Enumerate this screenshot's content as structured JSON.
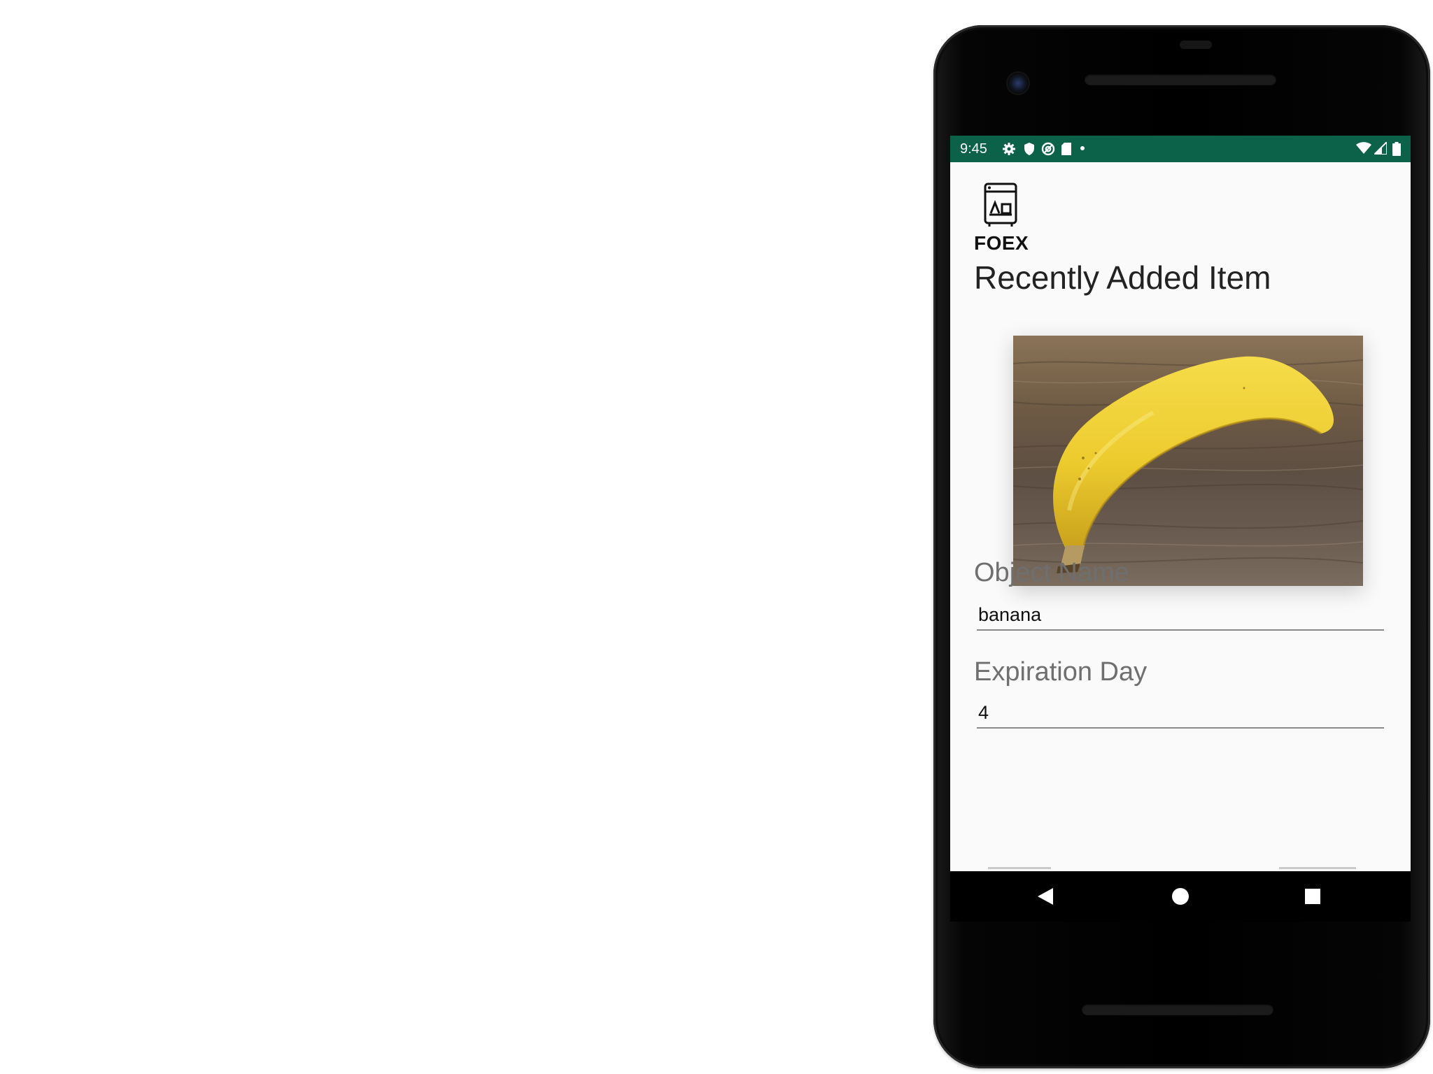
{
  "status_bar": {
    "time": "9:45",
    "background_color": "#0c6149",
    "icons": [
      "settings-gear-icon",
      "shield-icon",
      "at-sign-icon",
      "sd-card-icon",
      "dot-icon",
      "wifi-icon",
      "cell-signal-icon",
      "battery-icon"
    ]
  },
  "app": {
    "logo_text": "FOEX",
    "logo_icon": "fridge-icon",
    "heading": "Recently Added Item",
    "image": {
      "subject": "banana-photo"
    },
    "fields": {
      "object_name": {
        "label": "Object Name",
        "value": "banana"
      },
      "expiration_day": {
        "label": "Expiration Day",
        "value": "4"
      }
    }
  },
  "nav_bar": {
    "icons": [
      "back-icon",
      "home-icon",
      "recents-icon"
    ]
  }
}
